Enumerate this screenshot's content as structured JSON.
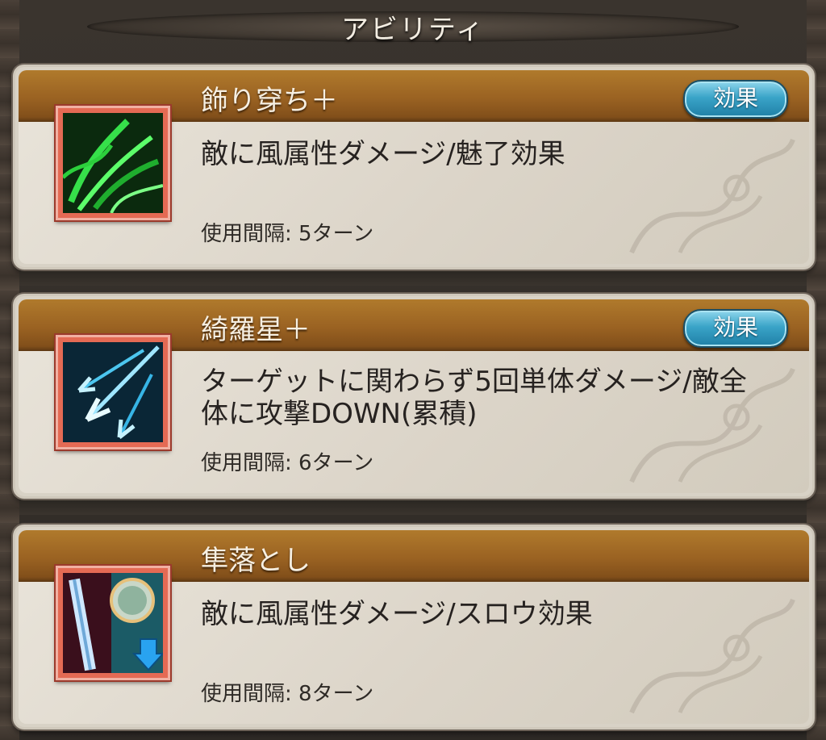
{
  "header": {
    "title": "アビリティ"
  },
  "abilities": [
    {
      "name": "飾り穿ち＋",
      "description": "敵に風属性ダメージ/魅了効果",
      "cooldown": "使用間隔: 5ターン",
      "effect_label": "効果",
      "icon": "green-leaf-slash-icon"
    },
    {
      "name": "綺羅星＋",
      "description": "ターゲットに関わらず5回単体ダメージ/敵全体に攻撃DOWN(累積)",
      "cooldown": "使用間隔: 6ターン",
      "effect_label": "効果",
      "icon": "blue-arrow-volley-icon"
    },
    {
      "name": "隼落とし",
      "description": "敵に風属性ダメージ/スロウ効果",
      "cooldown": "使用間隔: 8ターン",
      "icon": "sword-slow-down-icon"
    }
  ],
  "colors": {
    "band": "#9a6222",
    "card": "#e2ddd2",
    "button": "#3aa4c8",
    "icon_frame": "#e46a54"
  }
}
